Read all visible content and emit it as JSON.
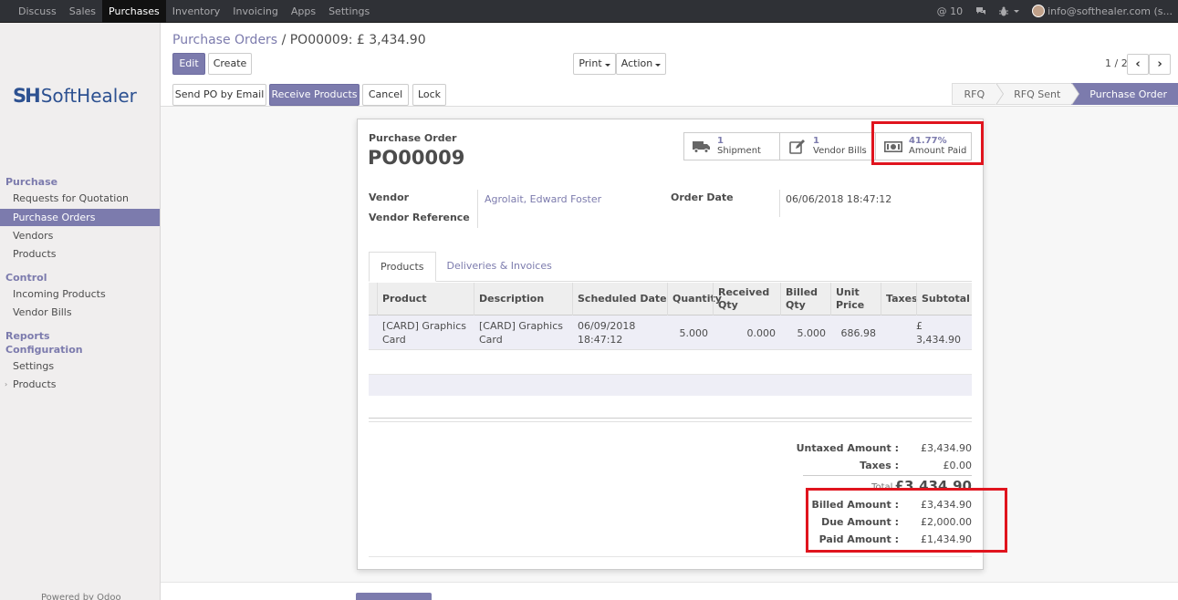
{
  "topbar": {
    "menu": [
      "Discuss",
      "Sales",
      "Purchases",
      "Inventory",
      "Invoicing",
      "Apps",
      "Settings"
    ],
    "active_index": 2,
    "notifications": "@ 10",
    "user": "info@softhealer.com (s..."
  },
  "sidebar": {
    "logo_mark": "SH",
    "logo_text": "SoftHealer",
    "sections": {
      "purchase": "Purchase",
      "control": "Control",
      "reports": "Reports",
      "configuration": "Configuration"
    },
    "items": {
      "rfq": "Requests for Quotation",
      "purchase_orders": "Purchase Orders",
      "vendors": "Vendors",
      "products": "Products",
      "incoming_products": "Incoming Products",
      "vendor_bills": "Vendor Bills",
      "settings": "Settings",
      "config_products": "Products"
    },
    "powered": "Powered by Odoo"
  },
  "breadcrumb": {
    "parent": "Purchase Orders",
    "separator": "/",
    "current": "PO00009: £ 3,434.90"
  },
  "buttons": {
    "edit": "Edit",
    "create": "Create",
    "print": "Print",
    "action": "Action",
    "send_po": "Send PO by Email",
    "receive": "Receive Products",
    "cancel": "Cancel",
    "lock": "Lock"
  },
  "pager": {
    "value": "1 / 2"
  },
  "stages": [
    "RFQ",
    "RFQ Sent",
    "Purchase Order"
  ],
  "smart_buttons": {
    "shipment": {
      "count": "1",
      "label": "Shipment"
    },
    "vendor_bills": {
      "count": "1",
      "label": "Vendor Bills"
    },
    "amount_paid": {
      "value": "41.77%",
      "label": "Amount Paid"
    }
  },
  "form": {
    "doc_label": "Purchase Order",
    "doc_name": "PO00009",
    "vendor_label": "Vendor",
    "vendor": "Agrolait, Edward Foster",
    "vendor_ref_label": "Vendor Reference",
    "order_date_label": "Order Date",
    "order_date": "06/06/2018 18:47:12"
  },
  "tabs": [
    "Products",
    "Deliveries & Invoices"
  ],
  "table": {
    "headers": {
      "product": "Product",
      "description": "Description",
      "scheduled": "Scheduled Date",
      "quantity": "Quantity",
      "received1": "Received",
      "received2": "Qty",
      "billed1": "Billed",
      "billed2": "Qty",
      "unit1": "Unit",
      "unit2": "Price",
      "taxes": "Taxes",
      "subtotal": "Subtotal"
    },
    "rows": [
      {
        "product1": "[CARD] Graphics",
        "product2": "Card",
        "description1": "[CARD] Graphics",
        "description2": "Card",
        "date1": "06/09/2018",
        "date2": "18:47:12",
        "quantity": "5.000",
        "received": "0.000",
        "billed": "5.000",
        "unit_price": "686.98",
        "taxes": "",
        "subtotal": "£ 3,434.90"
      }
    ]
  },
  "totals": {
    "untaxed_label": "Untaxed Amount :",
    "untaxed": "£3,434.90",
    "taxes_label": "Taxes :",
    "taxes": "£0.00",
    "total_label": "Total :",
    "total": "£3,434.90",
    "billed_label": "Billed Amount :",
    "billed": "£3,434.90",
    "due_label": "Due Amount :",
    "due": "£2,000.00",
    "paid_label": "Paid Amount :",
    "paid": "£1,434.90"
  },
  "colors": {
    "accent": "#7c7bad",
    "highlight": "#e0141e",
    "topbar": "#2f3136"
  }
}
